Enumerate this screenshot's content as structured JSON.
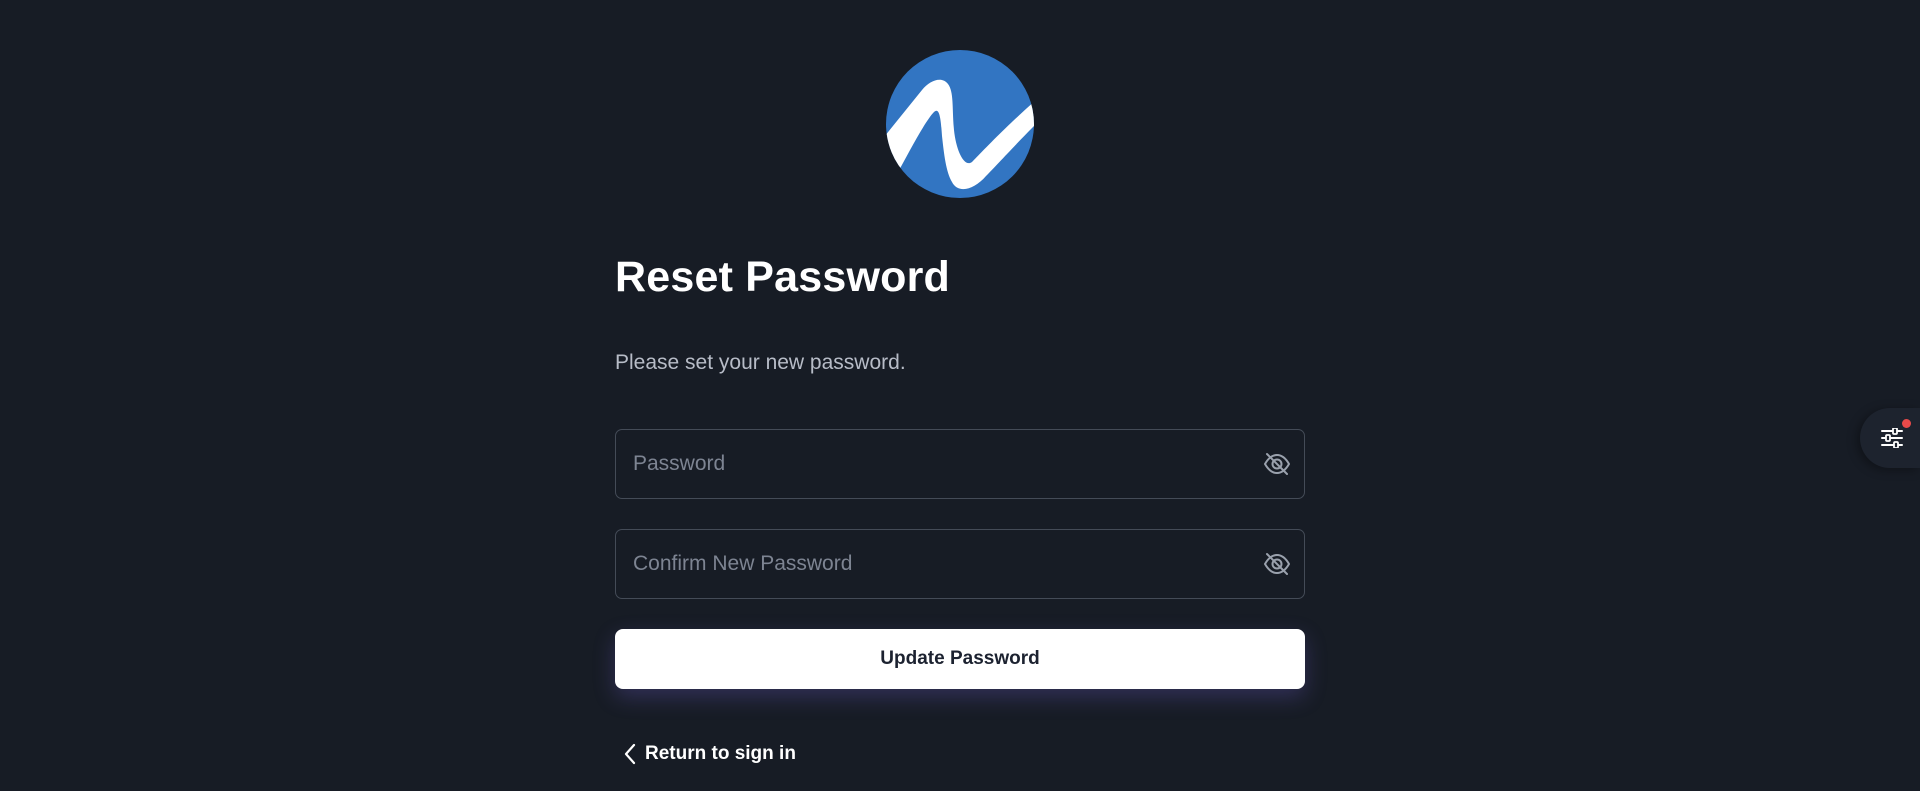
{
  "brand": {
    "logo_icon": "brand-wave-logo",
    "logo_color": "#3275c2"
  },
  "reset": {
    "title": "Reset Password",
    "subtitle": "Please set your new password.",
    "password_placeholder": "Password",
    "password_value": "",
    "confirm_placeholder": "Confirm New Password",
    "confirm_value": "",
    "visibility_icon": "eye-off-icon",
    "submit_label": "Update Password",
    "back_label": "Return to sign in",
    "back_icon": "chevron-left-icon"
  },
  "settings": {
    "icon": "sliders-icon",
    "notification_dot_color": "#e84a4a"
  },
  "colors": {
    "background": "#171c25",
    "accent": "#3275c2",
    "button_bg": "#ffffff",
    "button_text": "#1c2230"
  }
}
